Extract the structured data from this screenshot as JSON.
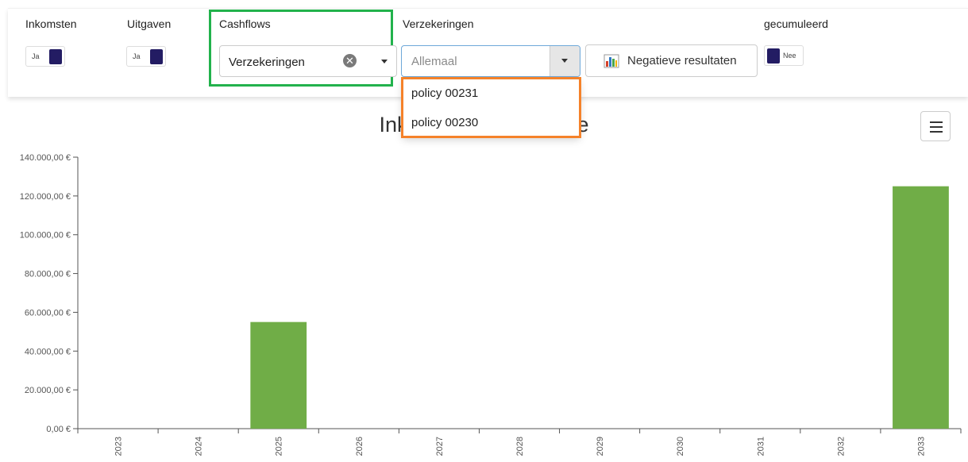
{
  "filters": {
    "income": {
      "label": "Inkomsten",
      "toggle": "Ja"
    },
    "expenses": {
      "label": "Uitgaven",
      "toggle": "Ja"
    },
    "cashflows": {
      "label": "Cashflows",
      "value": "Verzekeringen",
      "clear_glyph": "✕"
    },
    "insurances": {
      "label": "Verzekeringen",
      "placeholder": "Allemaal",
      "options": [
        "policy 00231",
        "policy 00230"
      ]
    },
    "negative_button": {
      "label": "Negatieve resultaten",
      "icon": "bar-chart-icon"
    },
    "cumulative": {
      "label": "gecumuleerd",
      "toggle": "Nee"
    }
  },
  "colors": {
    "toggle_on": "#231c63",
    "bar": "#70ad47",
    "highlight_green": "#22b24c",
    "highlight_orange": "#f5822a"
  },
  "chart_data": {
    "type": "bar",
    "title": "Inkomsten ... projectie",
    "categories": [
      "2023",
      "2024",
      "2025",
      "2026",
      "2027",
      "2028",
      "2029",
      "2030",
      "2031",
      "2032",
      "2033"
    ],
    "values": [
      0,
      0,
      55000,
      0,
      0,
      0,
      0,
      0,
      0,
      0,
      125000
    ],
    "ylim": [
      0,
      140000
    ],
    "yticks": [
      0,
      20000,
      40000,
      60000,
      80000,
      100000,
      120000,
      140000
    ],
    "ytick_labels": [
      "0,00 €",
      "20.000,00 €",
      "40.000,00 €",
      "60.000,00 €",
      "80.000,00 €",
      "100.000,00 €",
      "120.000,00 €",
      "140.000,00 €"
    ],
    "color": "#70ad47",
    "grid": false
  }
}
